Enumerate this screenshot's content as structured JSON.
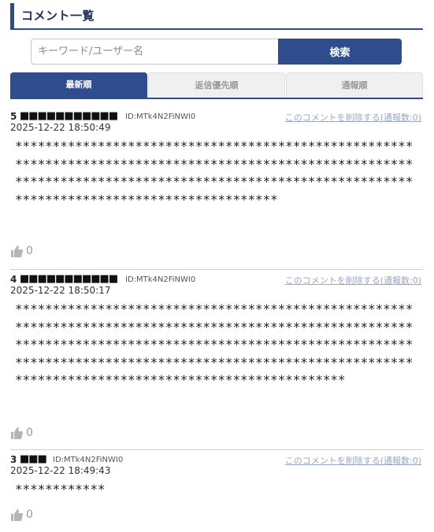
{
  "section": {
    "title": "コメント一覧"
  },
  "search": {
    "placeholder": "キーワード/ユーザー名",
    "button_label": "検索"
  },
  "tabs": [
    {
      "label": "最新順",
      "active": true
    },
    {
      "label": "返信優先順",
      "active": false
    },
    {
      "label": "通報順",
      "active": false
    }
  ],
  "comments": [
    {
      "number": "5",
      "name": "■■■■■■■■■■■",
      "id": "ID:MTk4N2FiNWI0",
      "delete_label": "このコメントを削除する(通報数:0)",
      "date": "2025-12-22 18:50:49",
      "body": "**************************************************************************************************************************************************************************************************",
      "likes": "0"
    },
    {
      "number": "4",
      "name": "■■■■■■■■■■■",
      "id": "ID:MTk4N2FiNWI0",
      "delete_label": "このコメントを削除する(通報数:0)",
      "date": "2025-12-22 18:50:17",
      "body": "****************************************************************************************************************************************************************************************************************************************************************",
      "likes": "0"
    },
    {
      "number": "3",
      "name": "■■■",
      "id": "ID:MTk4N2FiNWI0",
      "delete_label": "このコメントを削除する(通報数:0)",
      "date": "2025-12-22 18:49:43",
      "body": "************",
      "likes": "0"
    }
  ],
  "colors": {
    "accent": "#2f4d8c",
    "link": "#9aa7c3"
  },
  "icons": {
    "like": "thumbs-up-icon"
  }
}
